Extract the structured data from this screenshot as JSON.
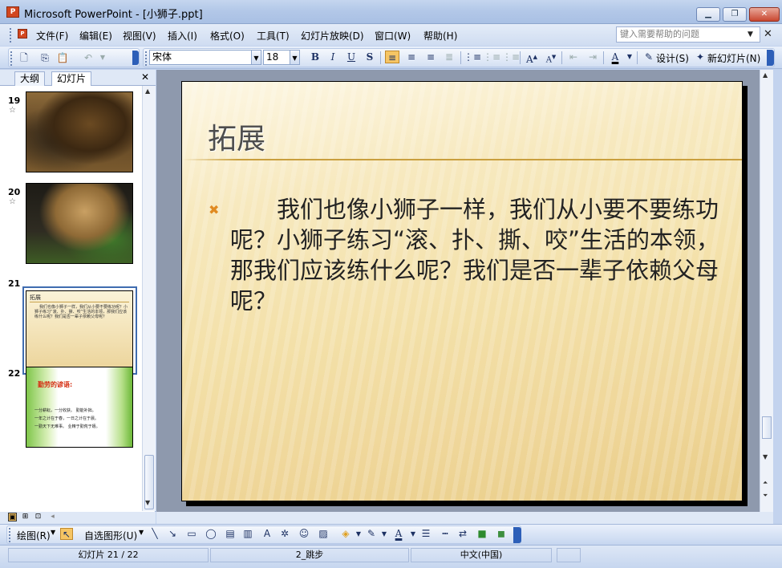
{
  "window": {
    "app_icon": "P",
    "title": "Microsoft PowerPoint - [小狮子.ppt]",
    "min_label": "▁",
    "max_label": "❐",
    "close_label": "✕"
  },
  "menu": {
    "items": [
      "文件(F)",
      "编辑(E)",
      "视图(V)",
      "插入(I)",
      "格式(O)",
      "工具(T)",
      "幻灯片放映(D)",
      "窗口(W)",
      "帮助(H)"
    ],
    "help_placeholder": "键入需要帮助的问题",
    "help_arrow": "▼",
    "close_label": "✕"
  },
  "toolbar": {
    "font_name": "宋体",
    "font_size": "18",
    "bold": "B",
    "italic": "I",
    "underline": "U",
    "shadow": "S",
    "design_label": "设计(S)",
    "new_slide_label": "新幻灯片(N)",
    "combo_arrow": "▼"
  },
  "left_pane": {
    "tab_outline": "大纲",
    "tab_slides": "幻灯片",
    "close_label": "✕",
    "slides": [
      {
        "number": "19",
        "star": "☆"
      },
      {
        "number": "20",
        "star": "☆"
      },
      {
        "number": "21"
      },
      {
        "number": "22"
      }
    ],
    "thumb21": {
      "title": "拓展",
      "text": "我们也像小狮子一样，我们从小要不要练功呢？小狮子练习“滚、扑、撕、咬”生活的本领，那我们应该练什么呢？我们是否一辈子依赖父母呢？"
    },
    "thumb22": {
      "title": "勤劳的谚语:",
      "lines": [
        "一分耕耘，一分收获。  勤能补拙。",
        "一年之计在于春，一日之计在于晨。",
        "一勤天下无难事。  业精于勤荒于嬉。"
      ]
    }
  },
  "slide": {
    "title": "拓展",
    "bullet": "✖",
    "body": "我们也像小狮子一样，我们从小要不要练功呢？小狮子练习“滚、扑、撕、咬”生活的本领，那我们应该练什么呢？我们是否一辈子依赖父母呢？"
  },
  "draw_toolbar": {
    "draw_label": "绘图(R)",
    "autoshapes_label": "自选图形(U)"
  },
  "status": {
    "slide_info": "幻灯片 21 / 22",
    "template": "2_跳步",
    "language": "中文(中国)"
  }
}
